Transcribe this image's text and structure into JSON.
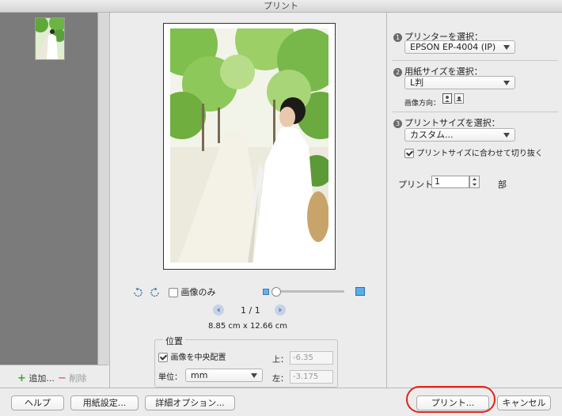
{
  "window": {
    "title": "プリント"
  },
  "left": {
    "add_label": "追加...",
    "delete_label": "削除"
  },
  "preview": {
    "image_only_label": "画像のみ",
    "page_indicator": "1 / 1",
    "dimensions": "8.85 cm x 12.66 cm",
    "position_title": "位置",
    "center_label": "画像を中央配置",
    "unit_label": "単位：",
    "unit_value": "mm",
    "top_label": "上：",
    "top_value": "-6.35",
    "left_label": "左：",
    "left_value": "-3.175"
  },
  "right": {
    "step1_num": "1",
    "step1_label": "プリンターを選択：",
    "printer": "EPSON EP-4004 (IP)",
    "step2_num": "2",
    "step2_label": "用紙サイズを選択：",
    "paper": "L判",
    "orientation_label": "画像方向：",
    "step3_num": "3",
    "step3_label": "プリントサイズを選択：",
    "print_size": "カスタム...",
    "crop_label": "プリントサイズに合わせて切り抜く",
    "copies_label": "プリント",
    "copies_value": "1",
    "copies_unit": "部"
  },
  "bottom": {
    "help": "ヘルプ",
    "page_setup": "用紙設定...",
    "detail_options": "詳細オプション...",
    "print": "プリント...",
    "cancel": "キャンセル"
  },
  "colors": {
    "accent": "#3b87d8",
    "highlight": "#e2231a"
  }
}
